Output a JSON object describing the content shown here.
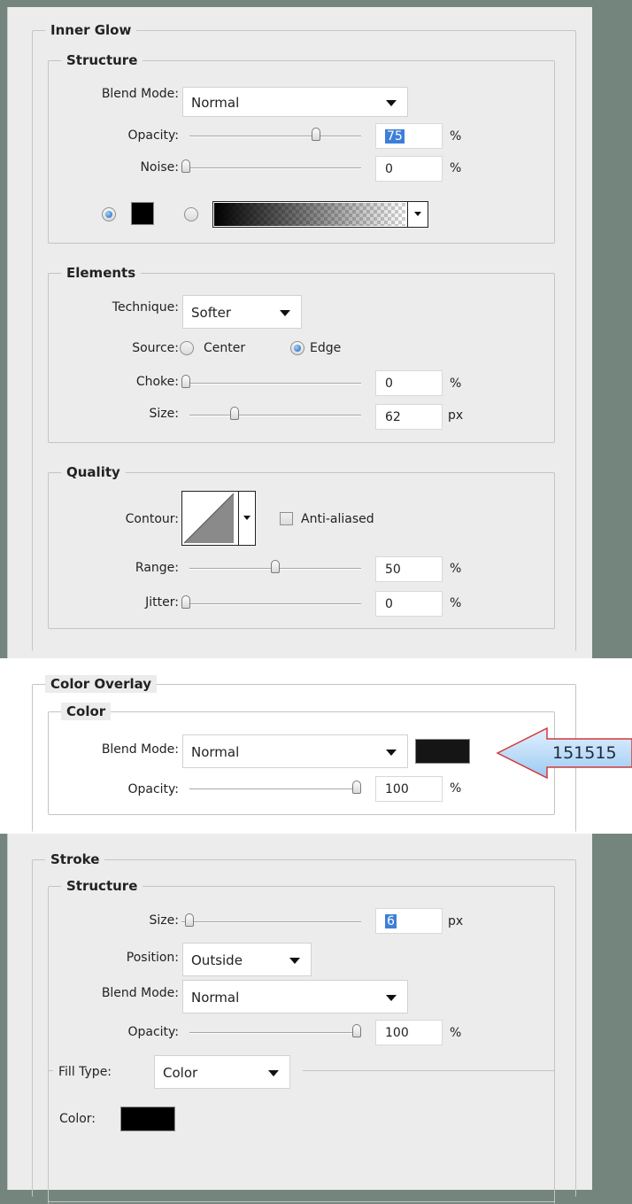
{
  "inner_glow": {
    "title": "Inner Glow",
    "structure": {
      "title": "Structure",
      "blend_mode": {
        "label": "Blend Mode:",
        "value": "Normal"
      },
      "opacity": {
        "label": "Opacity:",
        "value": "75",
        "unit": "%",
        "level": 0.75
      },
      "noise": {
        "label": "Noise:",
        "value": "0",
        "unit": "%",
        "level": 0
      },
      "glow_color_choice": "solid",
      "glow_color": "#000000"
    },
    "elements": {
      "title": "Elements",
      "technique": {
        "label": "Technique:",
        "value": "Softer"
      },
      "source": {
        "label": "Source:",
        "option_center": "Center",
        "option_edge": "Edge",
        "selected": "Edge"
      },
      "choke": {
        "label": "Choke:",
        "value": "0",
        "unit": "%",
        "level": 0
      },
      "size": {
        "label": "Size:",
        "value": "62",
        "unit": "px",
        "level": 0.25
      }
    },
    "quality": {
      "title": "Quality",
      "contour": {
        "label": "Contour:"
      },
      "anti_aliased": {
        "label": "Anti-aliased",
        "checked": false
      },
      "range": {
        "label": "Range:",
        "value": "50",
        "unit": "%",
        "level": 0.5
      },
      "jitter": {
        "label": "Jitter:",
        "value": "0",
        "unit": "%",
        "level": 0
      }
    }
  },
  "color_overlay": {
    "title": "Color Overlay",
    "color_group": {
      "title": "Color",
      "blend_mode": {
        "label": "Blend Mode:",
        "value": "Normal"
      },
      "overlay_color": "#151515",
      "opacity": {
        "label": "Opacity:",
        "value": "100",
        "unit": "%",
        "level": 1.0
      }
    },
    "callout_text": "151515"
  },
  "stroke": {
    "title": "Stroke",
    "structure": {
      "title": "Structure",
      "size": {
        "label": "Size:",
        "value": "6",
        "unit": "px",
        "level": 0.02
      },
      "position": {
        "label": "Position:",
        "value": "Outside"
      },
      "blend_mode": {
        "label": "Blend Mode:",
        "value": "Normal"
      },
      "opacity": {
        "label": "Opacity:",
        "value": "100",
        "unit": "%",
        "level": 1.0
      }
    },
    "fill": {
      "fill_type_label": "Fill Type:",
      "fill_type_value": "Color",
      "color_label": "Color:",
      "color": "#000000"
    }
  }
}
